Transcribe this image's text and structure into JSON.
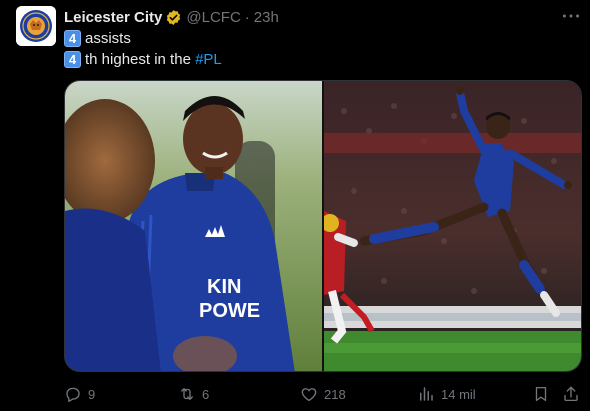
{
  "tweet": {
    "author_name": "Leicester City",
    "handle": "@LCFC",
    "separator": "·",
    "time": "23h",
    "lines": [
      {
        "keycap": "4",
        "text": "assists"
      },
      {
        "keycap": "4",
        "text": "th highest in the ",
        "hashtag": "#PL"
      }
    ]
  },
  "media": {
    "left_photo": {
      "shirt_text_line1": "KIN",
      "shirt_text_line2": "POWE"
    },
    "right_photo": {}
  },
  "actions": {
    "replies": "9",
    "reposts": "6",
    "likes": "218",
    "views": "14 mil"
  },
  "colors": {
    "background": "#000000",
    "text": "#e7e9ea",
    "muted": "#71767b",
    "link": "#1d9bf0",
    "verified": "#e2b719",
    "keycap": "#4a8fe8",
    "lcfc_blue": "#1f3d9e"
  },
  "icons": {
    "more": "more-dots-icon",
    "reply": "reply-icon",
    "repost": "repost-icon",
    "like": "heart-icon",
    "views": "views-chart-icon",
    "bookmark": "bookmark-icon",
    "share": "share-icon",
    "verified": "verified-badge-icon"
  }
}
